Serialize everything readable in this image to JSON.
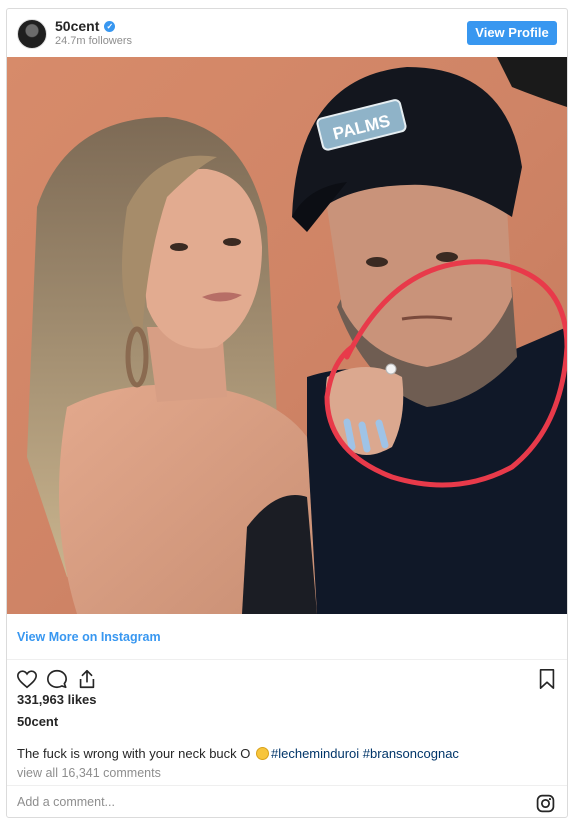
{
  "header": {
    "username": "50cent",
    "verified_mark": "✓",
    "followers": "24.7m followers",
    "view_profile_label": "View Profile"
  },
  "photo": {
    "cap_text": "PALMS",
    "annotation_color": "#e83a4a"
  },
  "footer": {
    "view_more_label": "View More on Instagram",
    "likes": "331,963 likes",
    "owner": "50cent",
    "caption_text": "The fuck is wrong with your neck buck O",
    "caption_emoji": "worried-face-emoji",
    "hashtag_1": "#lecheminduroi",
    "hashtag_2": "#bransoncognac",
    "view_all_comments": "view all 16,341 comments",
    "comment_placeholder": "Add a comment..."
  },
  "icons": {
    "like": "heart-outline-icon",
    "comment": "speech-bubble-icon",
    "share": "share-upload-icon",
    "save": "bookmark-icon",
    "instagram": "instagram-glyph-icon"
  },
  "colors": {
    "accent": "#3897f0",
    "link": "#003569",
    "muted": "#8e8e8e",
    "text": "#262626"
  }
}
